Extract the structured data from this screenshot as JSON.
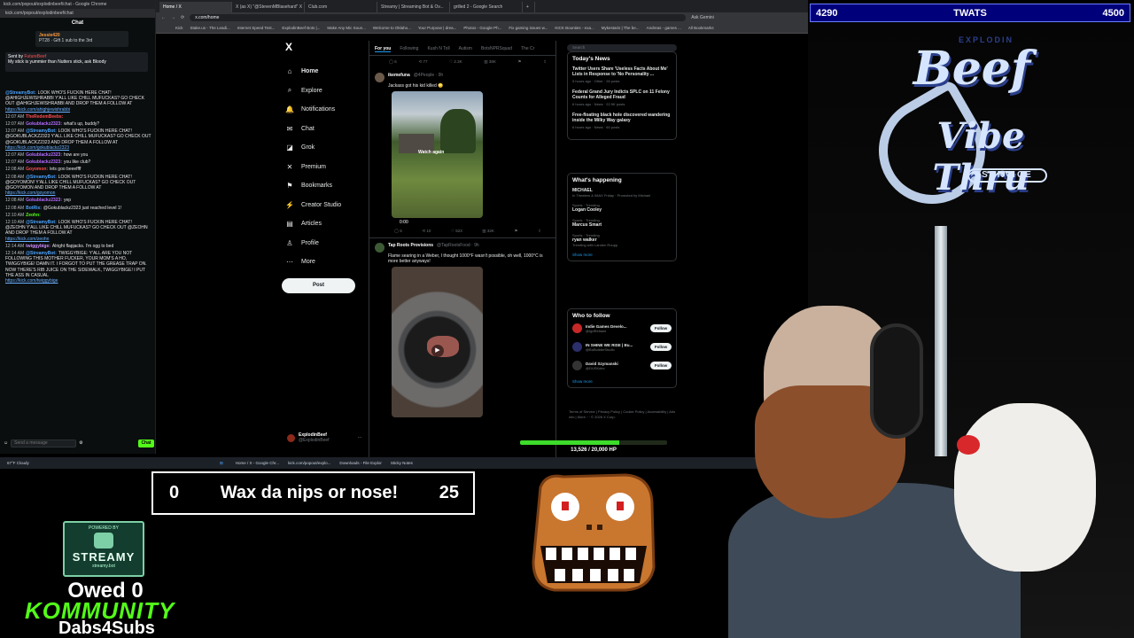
{
  "chat": {
    "window_title": "kick.com/popout/explodinbeef/chat - Google Chrome",
    "url": "kick.com/popout/explodinbeef/chat",
    "header": "Chat",
    "pinned_user": "Jessie420",
    "pinned_text": "PT28 · Gift 1 sub to the 3rd",
    "alert_by": "Sent by",
    "alert_user": "FutureBeef",
    "alert_text": "My stick is yummier than Nutters stick, ask Bloody",
    "messages": [
      {
        "time": "",
        "user": "@StreamyBot:",
        "user_color": "#4aa3ff",
        "text": "LOOK WHO'S FUCKIN HERE CHAT! @AHIGHJEWISHRABBI Y'ALL LIKE CHILL MUFUCKAS? GO CHECK OUT @AHIGHJEWISHRABBI AND DROP THEM A FOLLOW AT",
        "link": "https://kick.com/ahighjewishrabbi"
      },
      {
        "time": "12:07 AM",
        "user": "TheRedemBeebs:",
        "user_color": "#ff4d4d",
        "text": "",
        "link": ""
      },
      {
        "time": "12:07 AM",
        "user": "Gokublackz2323:",
        "user_color": "#b46bff",
        "text": "what's up, buddy?",
        "link": ""
      },
      {
        "time": "12:07 AM",
        "user": "@StreamyBot:",
        "user_color": "#4aa3ff",
        "text": "LOOK WHO'S FUCKIN HERE CHAT! @GOKUBLACKZ2323 Y'ALL LIKE CHILL MUFUCKAS? GO CHECK OUT @GOKUBLACKZ2323 AND DROP THEM A FOLLOW AT",
        "link": "https://kick.com/gokublackz2323"
      },
      {
        "time": "12:07 AM",
        "user": "Gokublackz2323:",
        "user_color": "#b46bff",
        "text": "how are you",
        "link": ""
      },
      {
        "time": "12:07 AM",
        "user": "Gokublackz2323:",
        "user_color": "#b46bff",
        "text": "you like club?",
        "link": ""
      },
      {
        "time": "12:08 AM",
        "user": "Goyomon:",
        "user_color": "#ff4d4d",
        "text": "lets goo beeeffff",
        "link": ""
      },
      {
        "time": "12:08 AM",
        "user": "@StreamyBot:",
        "user_color": "#4aa3ff",
        "text": "LOOK WHO'S FUCKIN HERE CHAT! @GOYOMON! Y'ALL LIKE CHILL MUFUCKAS? GO CHECK OUT @GOYOMON AND DROP THEM A FOLLOW AT",
        "link": "https://kick.com/goyomon"
      },
      {
        "time": "12:08 AM",
        "user": "Gokublackz2323:",
        "user_color": "#b46bff",
        "text": "yep",
        "link": ""
      },
      {
        "time": "12:08 AM",
        "user": "BotRix:",
        "user_color": "#4aa3ff",
        "text": "@Gokublackz2323 just reached level 1!",
        "link": ""
      },
      {
        "time": "12:10 AM",
        "user": "Zeohn:",
        "user_color": "#53fc18",
        "text": "",
        "link": ""
      },
      {
        "time": "12:10 AM",
        "user": "@StreamyBot:",
        "user_color": "#4aa3ff",
        "text": "LOOK WHO'S FUCKIN HERE CHAT! @ZEOHN Y'ALL LIKE CHILL MUFUCKAS? GO CHECK OUT @ZEOHN AND DROP THEM A FOLLOW AT",
        "link": "https://kick.com/zeohn"
      },
      {
        "time": "12:14 AM",
        "user": "twiggybige:",
        "user_color": "#d08bff",
        "text": "Alright flapjacks. I'm ogg to bed",
        "link": ""
      },
      {
        "time": "12:14 AM",
        "user": "@StreamyBot:",
        "user_color": "#4aa3ff",
        "text": "TWIGGYBIGE: Y'ALL ARE YOU NOT FOLLOWING THIS MOTHER FUCKER, YOUR MOM'S A HO, TWIGGYBIGE! DAMN IT. I FORGOT TO PUT THE GREASE TRAP ON. NOW THERE'S RIB JUICE ON THE SIDEWALK, TWIGGYBIGE! I PUT THE ASS IN CASUAL",
        "link": "https://kick.com/twiggybige"
      }
    ],
    "input_placeholder": "Send a message",
    "send_label": "Chat"
  },
  "browser": {
    "tabs": [
      {
        "label": "Home / X",
        "active": true
      },
      {
        "label": "X (as X) \"@StevenMBlasehard\" X",
        "active": false
      },
      {
        "label": "Club.com",
        "active": false
      },
      {
        "label": "Streamy | Streaming Bot & Ov...",
        "active": false
      },
      {
        "label": "grilled 2 - Google Search",
        "active": false
      },
      {
        "label": "+",
        "active": false
      }
    ],
    "address": "x.com/home",
    "extra": "Ask Gemini",
    "bookmarks": [
      "Kick",
      "Stake.us - The Leadi...",
      "Internet Speed Test...",
      "ExplodinBeef Bots |...",
      "Make Any Mic Soun...",
      "Welcome to Oklaho...",
      "Your Purpose | drea...",
      "Photos - Google Ph...",
      "Fix gaming issues w...",
      "KICK Bounties - exa...",
      "Mykestaris | The be...",
      "Andreas - games ...",
      "All Bookmarks"
    ]
  },
  "x": {
    "logo": "X",
    "nav": [
      {
        "icon": "⌂",
        "name": "home",
        "label": "Home",
        "active": true
      },
      {
        "icon": "⌕",
        "name": "explore",
        "label": "Explore",
        "active": false
      },
      {
        "icon": "🔔",
        "name": "notifications",
        "label": "Notifications",
        "active": false
      },
      {
        "icon": "✉",
        "name": "chat",
        "label": "Chat",
        "active": false
      },
      {
        "icon": "◪",
        "name": "grok",
        "label": "Grok",
        "active": false
      },
      {
        "icon": "✕",
        "name": "premium",
        "label": "Premium",
        "active": false
      },
      {
        "icon": "⚑",
        "name": "bookmarks",
        "label": "Bookmarks",
        "active": false
      },
      {
        "icon": "⚡",
        "name": "creator-studio",
        "label": "Creator Studio",
        "active": false
      },
      {
        "icon": "▤",
        "name": "articles",
        "label": "Articles",
        "active": false
      },
      {
        "icon": "♙",
        "name": "profile",
        "label": "Profile",
        "active": false
      },
      {
        "icon": "⋯",
        "name": "more",
        "label": "More",
        "active": false
      }
    ],
    "post_label": "Post",
    "account_name": "ExplodinBeef",
    "account_handle": "@ExplodinBeef",
    "timeline_tabs": [
      "For you",
      "Following",
      "Kush N Toll",
      "Autism",
      "BotsNPRSquad",
      "The Cr"
    ],
    "top_actions": [
      "◯ 6",
      "⟲ 77",
      "♡ 2.3K",
      "▥ 38K",
      "⚑",
      "⇪"
    ],
    "tweets": [
      {
        "name": "ikemefuna",
        "handle": "@4People · 9h",
        "text": "Jackass got his kid killed 😳",
        "media_label": "Watch again",
        "timecode": "0:00",
        "actions": [
          "◯ 5",
          "⟲ 10",
          "♡ 523",
          "▥ 32K",
          "⚑",
          "⇪"
        ]
      },
      {
        "name": "Tap Roots Provisions",
        "handle": "@TapRootsFood · 9h",
        "text": "Flame searing in a Weber, I thought 1000°F wasn't possible, oh well, 1000°C is more better anyways!",
        "media_label": "▶",
        "timecode": "",
        "actions": []
      }
    ],
    "search_placeholder": "Search",
    "news_title": "Today's News",
    "news": [
      {
        "title": "Twitter Users Share 'Useless Facts About Me' Lists in Response to 'No Personality ...",
        "meta": "5 hours ago · Other · 26 posts"
      },
      {
        "title": "Federal Grand Jury Indicts SPLC on 11 Felony Counts for Alleged Fraud",
        "meta": "6 hours ago · News · 22.9K posts"
      },
      {
        "title": "Free-floating black hole discovered wandering inside the Milky Way galaxy",
        "meta": "6 hours ago · News · 60 posts"
      }
    ],
    "trends_title": "What's happening",
    "trends": [
      {
        "context": "",
        "name": "MICHAEL",
        "extra": "In Theaters & IMAX Friday · Promoted by Michael"
      },
      {
        "context": "Sports · Trending",
        "name": "Logan Cooley",
        "extra": ""
      },
      {
        "context": "Sports · Trending",
        "name": "Marcus Smart",
        "extra": ""
      },
      {
        "context": "Sports · Trending",
        "name": "ryan walker",
        "extra": "Trending with Landen Roupp"
      }
    ],
    "show_more": "Show more",
    "wtf_title": "Who to follow",
    "who_to_follow": [
      {
        "name": "Indie Games Develo...",
        "handle": "@IgdRetlaire",
        "color": "#c62828"
      },
      {
        "name": "IN SHINE WE RISE | Bu...",
        "handle": "@BuBuilderStudio",
        "color": "#2b2f6b"
      },
      {
        "name": "David Szymanski",
        "handle": "@DUSKdev",
        "color": "#333333"
      }
    ],
    "follow_label": "Follow",
    "footer": "Terms of Service | Privacy Policy | Cookie Policy | Accessibility | Ads info | More ··· © 2026 X Corp."
  },
  "taskbar": {
    "weather": "67°F Cloudy",
    "items": [
      "Home / X - Google Chr...",
      "kick.com/popout/explo...",
      "Downloads - File Explor",
      "Sticky Notes"
    ]
  },
  "hp": {
    "text": "13,526 / 20,000 HP",
    "fraction": 0.676
  },
  "vote": {
    "left": "4290",
    "center": "TWATS",
    "right": "4500"
  },
  "sign": {
    "sub": "EXPLODIN",
    "brand": "Beef",
    "tag": "Vibe Thru",
    "service": "SERVICE"
  },
  "poll": {
    "left": "0",
    "text": "Wax da nips or nose!",
    "right": "25"
  },
  "streamy": {
    "line1": "POWERED BY",
    "name": "STREAMY",
    "line2": "streamy.bot"
  },
  "owed": "Owed 0",
  "kommunity": "KOMMUNITY",
  "dabs": "Dabs4Subs"
}
